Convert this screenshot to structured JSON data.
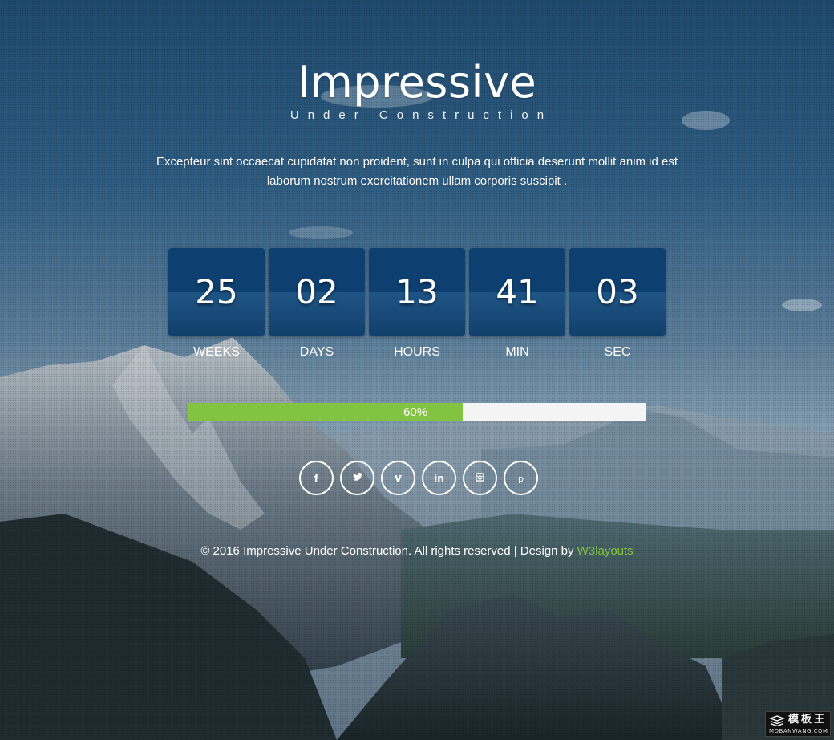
{
  "header": {
    "title": "Impressive",
    "subtitle": "Under Construction"
  },
  "description": "Excepteur sint occaecat cupidatat non proident, sunt in culpa qui officia deserunt mollit anim id est laborum nostrum exercitationem ullam corporis suscipit .",
  "countdown": [
    {
      "value": "25",
      "label": "WEEKS"
    },
    {
      "value": "02",
      "label": "DAYS"
    },
    {
      "value": "13",
      "label": "HOURS"
    },
    {
      "value": "41",
      "label": "MIN"
    },
    {
      "value": "03",
      "label": "SEC"
    }
  ],
  "progress": {
    "percent": 60,
    "label": "60%",
    "fill_color": "#82c341",
    "track_color": "#f4f4f4"
  },
  "social": [
    {
      "name": "facebook-icon",
      "glyph": "f"
    },
    {
      "name": "twitter-icon",
      "glyph": ""
    },
    {
      "name": "vimeo-icon",
      "glyph": "v"
    },
    {
      "name": "linkedin-icon",
      "glyph": "in"
    },
    {
      "name": "instagram-icon",
      "glyph": ""
    },
    {
      "name": "pinterest-icon",
      "glyph": "p"
    }
  ],
  "footer": {
    "text": "© 2016 Impressive Under Construction. All rights reserved | Design by ",
    "link_text": "W3layouts",
    "link_color": "#82c341"
  },
  "watermark": {
    "main": "模板王",
    "sub": "MOBANWANG.COM"
  },
  "colors": {
    "countdown_box": "#0d3f71",
    "text": "#ffffff"
  }
}
